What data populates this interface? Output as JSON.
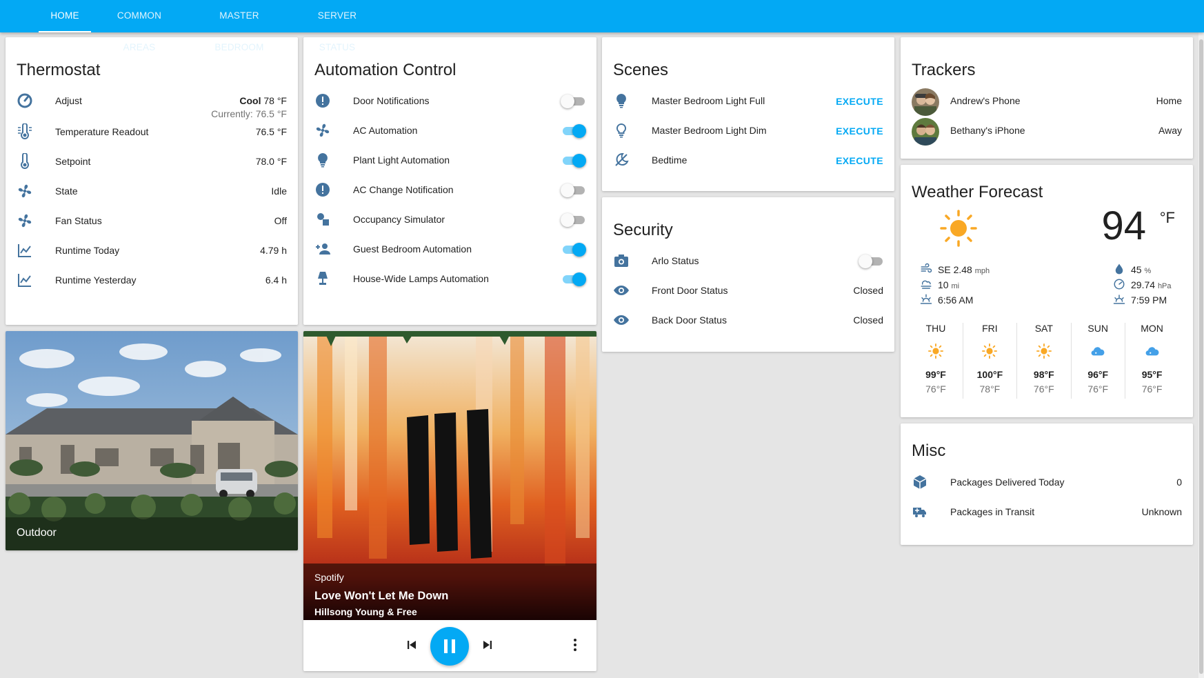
{
  "tabs": [
    "HOME",
    "COMMON AREAS",
    "MASTER BEDROOM",
    "SERVER STATUS"
  ],
  "thermostat": {
    "title": "Thermostat",
    "adjust_label": "Adjust",
    "adjust_mode": "Cool",
    "adjust_temp": "78 °F",
    "adjust_current": "Currently: 76.5 °F",
    "rows": [
      {
        "label": "Temperature Readout",
        "value": "76.5 °F",
        "icon": "thermometer-lines-icon"
      },
      {
        "label": "Setpoint",
        "value": "78.0 °F",
        "icon": "thermometer-icon"
      },
      {
        "label": "State",
        "value": "Idle",
        "icon": "fan-icon"
      },
      {
        "label": "Fan Status",
        "value": "Off",
        "icon": "fan-icon"
      },
      {
        "label": "Runtime Today",
        "value": "4.79 h",
        "icon": "chart-line-icon"
      },
      {
        "label": "Runtime Yesterday",
        "value": "6.4 h",
        "icon": "chart-line-icon"
      }
    ]
  },
  "automation": {
    "title": "Automation Control",
    "rows": [
      {
        "label": "Door Notifications",
        "on": false,
        "icon": "alert-circle-icon"
      },
      {
        "label": "AC Automation",
        "on": true,
        "icon": "fan-icon"
      },
      {
        "label": "Plant Light Automation",
        "on": true,
        "icon": "lightbulb-icon"
      },
      {
        "label": "AC Change Notification",
        "on": false,
        "icon": "alert-circle-icon"
      },
      {
        "label": "Occupancy Simulator",
        "on": false,
        "icon": "shapes-icon"
      },
      {
        "label": "Guest Bedroom Automation",
        "on": true,
        "icon": "account-plus-icon"
      },
      {
        "label": "House-Wide Lamps Automation",
        "on": true,
        "icon": "lamp-icon"
      }
    ]
  },
  "scenes": {
    "title": "Scenes",
    "execute_label": "EXECUTE",
    "rows": [
      {
        "label": "Master Bedroom Light Full",
        "icon": "lightbulb-icon"
      },
      {
        "label": "Master Bedroom Light Dim",
        "icon": "lightbulb-outline-icon"
      },
      {
        "label": "Bedtime",
        "icon": "weather-night-icon"
      }
    ]
  },
  "security": {
    "title": "Security",
    "arlo_label": "Arlo Status",
    "arlo_on": false,
    "rows": [
      {
        "label": "Front Door Status",
        "value": "Closed",
        "icon": "eye-icon"
      },
      {
        "label": "Back Door Status",
        "value": "Closed",
        "icon": "eye-icon"
      }
    ]
  },
  "trackers": {
    "title": "Trackers",
    "rows": [
      {
        "label": "Andrew's Phone",
        "value": "Home"
      },
      {
        "label": "Bethany's iPhone",
        "value": "Away"
      }
    ]
  },
  "weather": {
    "title": "Weather Forecast",
    "temp": "94",
    "unit": "°F",
    "wind": "SE 2.48",
    "wind_unit": "mph",
    "visibility": "10",
    "visibility_unit": "mi",
    "sunrise": "6:56 AM",
    "humidity": "45",
    "humidity_unit": "%",
    "pressure": "29.74",
    "pressure_unit": "hPa",
    "sunset": "7:59 PM",
    "forecast": [
      {
        "day": "THU",
        "hi": "99°F",
        "lo": "76°F",
        "icon": "sunny"
      },
      {
        "day": "FRI",
        "hi": "100°F",
        "lo": "78°F",
        "icon": "sunny"
      },
      {
        "day": "SAT",
        "hi": "98°F",
        "lo": "76°F",
        "icon": "sunny"
      },
      {
        "day": "SUN",
        "hi": "96°F",
        "lo": "76°F",
        "icon": "cloudy"
      },
      {
        "day": "MON",
        "hi": "95°F",
        "lo": "76°F",
        "icon": "cloudy"
      }
    ]
  },
  "misc": {
    "title": "Misc",
    "rows": [
      {
        "label": "Packages Delivered Today",
        "value": "0",
        "icon": "package-icon"
      },
      {
        "label": "Packages in Transit",
        "value": "Unknown",
        "icon": "truck-icon"
      }
    ]
  },
  "camera": {
    "label": "Outdoor"
  },
  "media": {
    "source": "Spotify",
    "title": "Love Won't Let Me Down",
    "artist": "Hillsong Young & Free"
  },
  "colors": {
    "accent": "#03a9f4",
    "icon": "#44739e",
    "weather_sun": "#f9a825",
    "weather_cloud": "#44a0e8"
  }
}
